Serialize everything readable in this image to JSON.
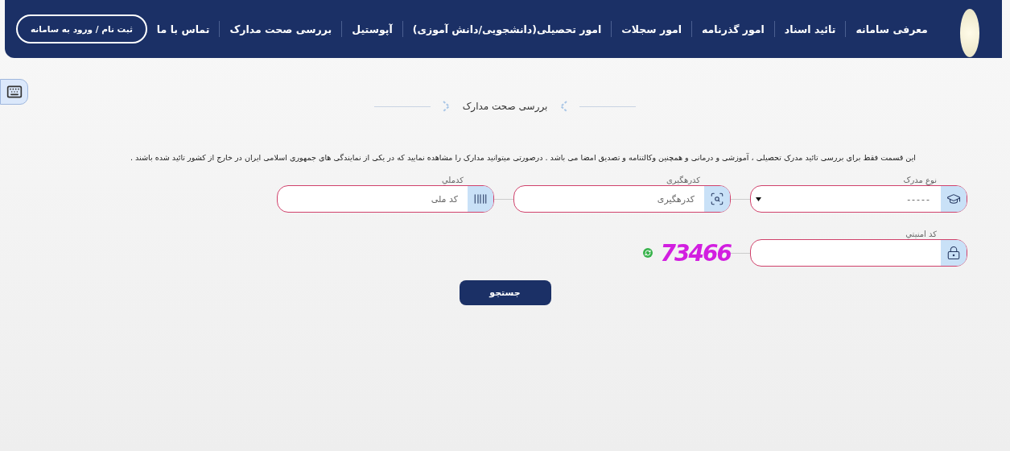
{
  "header": {
    "nav": [
      "معرفی سامانه",
      "تائید اسناد",
      "امور گذرنامه",
      "امور سجلات",
      "امور تحصیلی(دانشجویی/دانش آموزی)",
      "آپوستیل",
      "بررسی صحت مدارک",
      "تماس با ما"
    ],
    "login_button": "ثبت نام / ورود به سامانه"
  },
  "title": "بررسی صحت مدارک",
  "description": "این قسمت فقط برای بررسی تائید مدرک تحصیلی ، آموزشی و درمانی و همچنین وکالتنامه و تصدیق امضا می باشد . درصورتی میتوانید مدارک را مشاهده نمایید که در یکی از نمایندگی های جمهوری اسلامی ایران در خارج از کشور تائید شده باشند .",
  "fields": [
    {
      "kind": "select",
      "label": "نوع مدرک",
      "value": "-----"
    },
    {
      "kind": "text",
      "label": "کدرهگیری",
      "placeholder": "کدرهگیری"
    },
    {
      "kind": "text",
      "label": "کدملي",
      "placeholder": "کد ملی"
    }
  ],
  "security": {
    "label": "کد امنيتي",
    "captcha": "73466"
  },
  "search_button": "جستجو"
}
